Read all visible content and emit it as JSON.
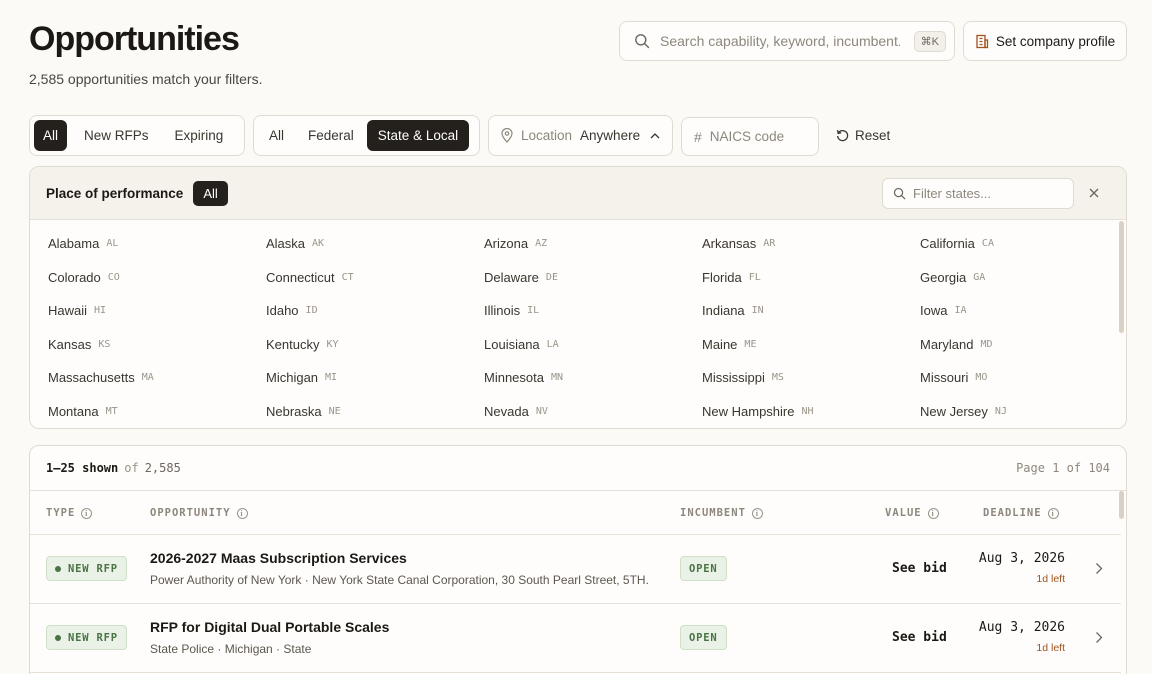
{
  "header": {
    "title": "Opportunities",
    "subtitle": "2,585 opportunities match your filters.",
    "search_placeholder": "Search capability, keyword, incumbent...",
    "search_shortcut": "⌘K",
    "profile_button": "Set company profile"
  },
  "filters": {
    "status": [
      "All",
      "New RFPs",
      "Expiring"
    ],
    "status_active": "All",
    "level": [
      "All",
      "Federal",
      "State & Local"
    ],
    "level_active": "State & Local",
    "location_label": "Location",
    "location_value": "Anywhere",
    "naics_placeholder": "NAICS code",
    "reset_label": "Reset"
  },
  "place_of_performance": {
    "title": "Place of performance",
    "all_label": "All",
    "filter_placeholder": "Filter states...",
    "states": [
      {
        "name": "Alabama",
        "abbr": "AL"
      },
      {
        "name": "Alaska",
        "abbr": "AK"
      },
      {
        "name": "Arizona",
        "abbr": "AZ"
      },
      {
        "name": "Arkansas",
        "abbr": "AR"
      },
      {
        "name": "California",
        "abbr": "CA"
      },
      {
        "name": "Colorado",
        "abbr": "CO"
      },
      {
        "name": "Connecticut",
        "abbr": "CT"
      },
      {
        "name": "Delaware",
        "abbr": "DE"
      },
      {
        "name": "Florida",
        "abbr": "FL"
      },
      {
        "name": "Georgia",
        "abbr": "GA"
      },
      {
        "name": "Hawaii",
        "abbr": "HI"
      },
      {
        "name": "Idaho",
        "abbr": "ID"
      },
      {
        "name": "Illinois",
        "abbr": "IL"
      },
      {
        "name": "Indiana",
        "abbr": "IN"
      },
      {
        "name": "Iowa",
        "abbr": "IA"
      },
      {
        "name": "Kansas",
        "abbr": "KS"
      },
      {
        "name": "Kentucky",
        "abbr": "KY"
      },
      {
        "name": "Louisiana",
        "abbr": "LA"
      },
      {
        "name": "Maine",
        "abbr": "ME"
      },
      {
        "name": "Maryland",
        "abbr": "MD"
      },
      {
        "name": "Massachusetts",
        "abbr": "MA"
      },
      {
        "name": "Michigan",
        "abbr": "MI"
      },
      {
        "name": "Minnesota",
        "abbr": "MN"
      },
      {
        "name": "Mississippi",
        "abbr": "MS"
      },
      {
        "name": "Missouri",
        "abbr": "MO"
      },
      {
        "name": "Montana",
        "abbr": "MT"
      },
      {
        "name": "Nebraska",
        "abbr": "NE"
      },
      {
        "name": "Nevada",
        "abbr": "NV"
      },
      {
        "name": "New Hampshire",
        "abbr": "NH"
      },
      {
        "name": "New Jersey",
        "abbr": "NJ"
      }
    ]
  },
  "results": {
    "shown": "1–25 shown",
    "of": "of",
    "total": "2,585",
    "page": "Page 1 of 104",
    "columns": {
      "type": "TYPE",
      "opportunity": "OPPORTUNITY",
      "incumbent": "INCUMBENT",
      "value": "VALUE",
      "deadline": "DEADLINE"
    },
    "rows": [
      {
        "type": "NEW RFP",
        "title": "2026-2027 Maas Subscription Services",
        "subtitle": "Power Authority of New York · New York State Canal Corporation, 30 South Pearl Street, 5TH...",
        "incumbent": "OPEN",
        "value": "See bid",
        "deadline": "Aug 3, 2026",
        "left": "1d left"
      },
      {
        "type": "NEW RFP",
        "title": "RFP for Digital Dual Portable Scales",
        "subtitle": "State Police · Michigan · State",
        "incumbent": "OPEN",
        "value": "See bid",
        "deadline": "Aug 3, 2026",
        "left": "1d left"
      }
    ]
  },
  "colors": {
    "background": "#fcfaf6",
    "active": "#24201b",
    "badge_green": "#4a7346",
    "deadline_left": "#a0521f"
  }
}
